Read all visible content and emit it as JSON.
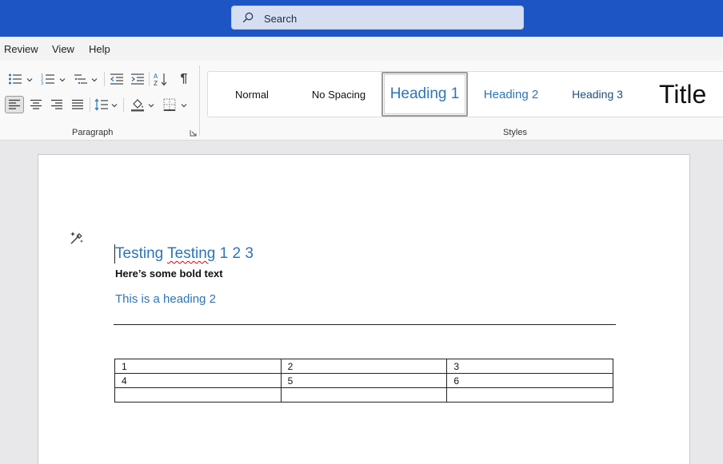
{
  "search": {
    "placeholder": "Search"
  },
  "menu": {
    "tabs": [
      "Review",
      "View",
      "Help"
    ]
  },
  "ribbon": {
    "paragraph_label": "Paragraph",
    "styles_label": "Styles",
    "styles": [
      "Normal",
      "No Spacing",
      "Heading 1",
      "Heading 2",
      "Heading 3",
      "Title"
    ],
    "active_style": "Heading 1",
    "pilcrow": "¶"
  },
  "document": {
    "heading1_part1": "Testing ",
    "heading1_misspelled": "Testing",
    "heading1_part2": " 1 2 3",
    "bold_text": "Here’s some bold text",
    "heading2": "This is a heading 2",
    "table": [
      [
        "1",
        "2",
        "3"
      ],
      [
        "4",
        "5",
        "6"
      ],
      [
        "",
        "",
        ""
      ]
    ]
  },
  "colors": {
    "titlebar": "#1e55c4",
    "heading": "#2e74b5",
    "accent": "#2e74b5"
  }
}
